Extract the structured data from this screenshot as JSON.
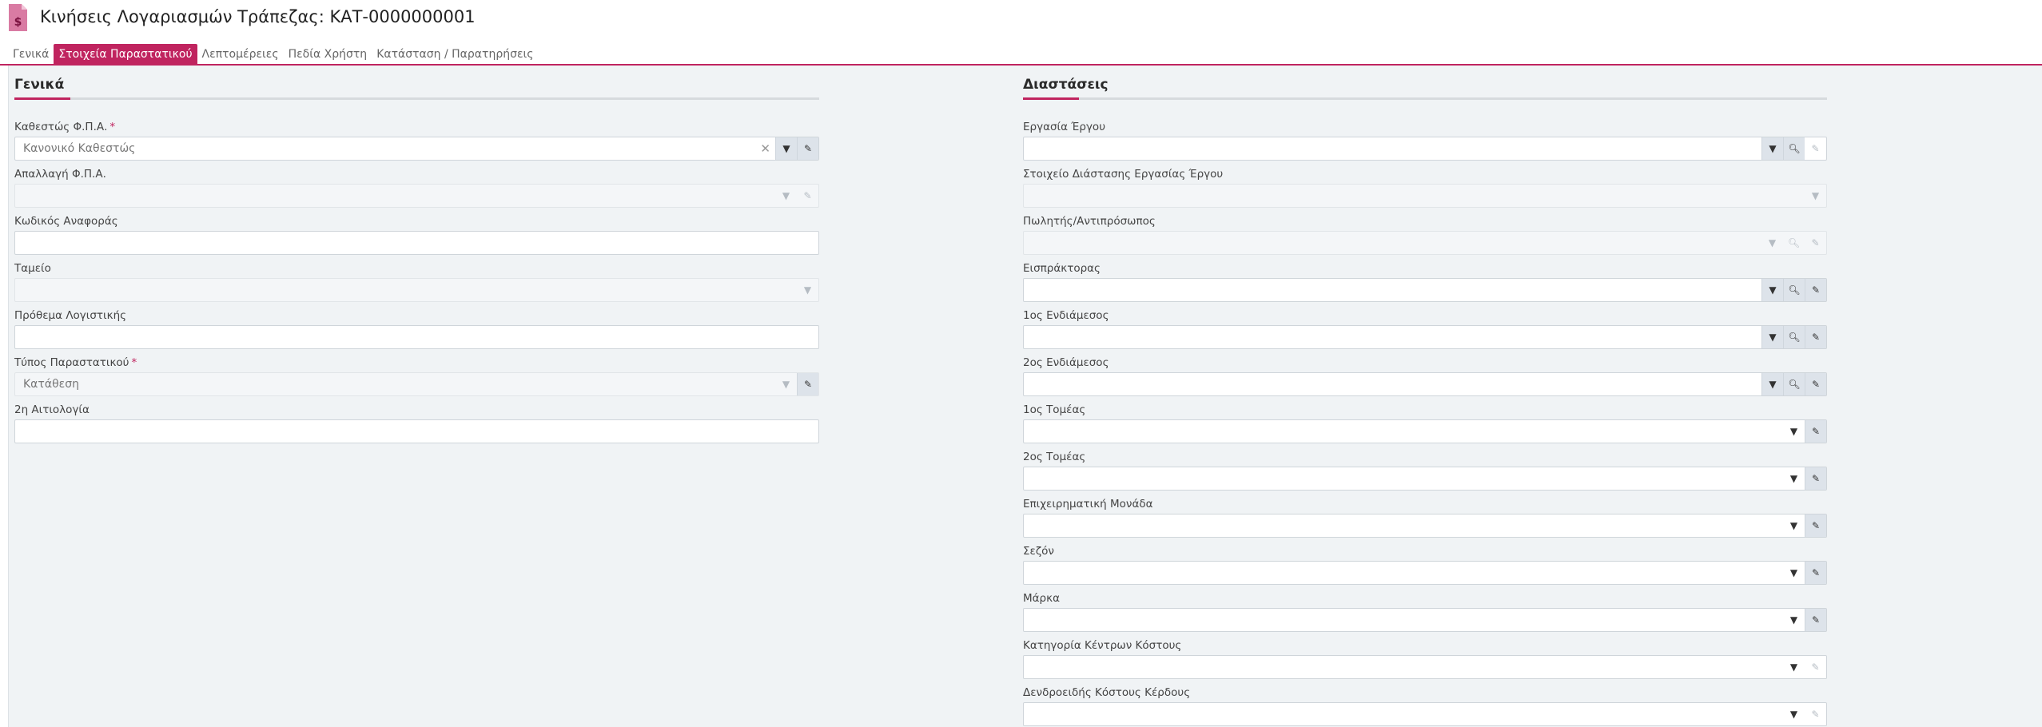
{
  "window": {
    "title": "Κινήσεις Λογαριασμών Τράπεζας: ΚΑΤ-0000000001"
  },
  "tabs": [
    {
      "label": "Γενικά",
      "active": false
    },
    {
      "label": "Στοιχεία Παραστατικού",
      "active": true
    },
    {
      "label": "Λεπτομέρειες",
      "active": false
    },
    {
      "label": "Πεδία Χρήστη",
      "active": false
    },
    {
      "label": "Κατάσταση / Παρατηρήσεις",
      "active": false
    }
  ],
  "left_section": {
    "title": "Γενικά",
    "fields": [
      {
        "label": "Καθεστώς Φ.Π.Α.",
        "required": true,
        "value": "Κανονικό Καθεστώς"
      },
      {
        "label": "Απαλλαγή Φ.Π.Α.",
        "required": false,
        "value": ""
      },
      {
        "label": "Κωδικός Αναφοράς",
        "required": false,
        "value": ""
      },
      {
        "label": "Ταμείο",
        "required": false,
        "value": ""
      },
      {
        "label": "Πρόθεμα Λογιστικής",
        "required": false,
        "value": ""
      },
      {
        "label": "Τύπος Παραστατικού",
        "required": true,
        "value": "Κατάθεση"
      },
      {
        "label": "2η Αιτιολογία",
        "required": false,
        "value": ""
      }
    ]
  },
  "right_section": {
    "title": "Διαστάσεις",
    "fields": [
      {
        "label": "Εργασία Έργου",
        "value": ""
      },
      {
        "label": "Στοιχείο Διάστασης Εργασίας Έργου",
        "value": ""
      },
      {
        "label": "Πωλητής/Αντιπρόσωπος",
        "value": ""
      },
      {
        "label": "Εισπράκτορας",
        "value": ""
      },
      {
        "label": "1ος Ενδιάμεσος",
        "value": ""
      },
      {
        "label": "2ος Ενδιάμεσος",
        "value": ""
      },
      {
        "label": "1ος Τομέας",
        "value": ""
      },
      {
        "label": "2ος Τομέας",
        "value": ""
      },
      {
        "label": "Επιχειρηματική Μονάδα",
        "value": ""
      },
      {
        "label": "Σεζόν",
        "value": ""
      },
      {
        "label": "Μάρκα",
        "value": ""
      },
      {
        "label": "Κατηγορία Κέντρων Κόστους",
        "value": ""
      },
      {
        "label": "Δενδροειδής Κόστους Κέρδους",
        "value": ""
      }
    ]
  },
  "icons": {
    "app": "document-dollar-icon",
    "dropdown": "caret-down-icon",
    "edit": "pencil-icon",
    "search": "search-icon",
    "clear": "clear-icon"
  },
  "colors": {
    "accent": "#c0245f",
    "panel_bg": "#f0f3f5",
    "button_bg": "#dde3ea"
  }
}
